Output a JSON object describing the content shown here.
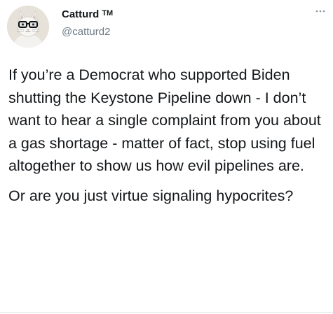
{
  "author": {
    "display_name": "Catturd",
    "badge": "TM",
    "handle": "@catturd2",
    "avatar_icon": "cat-with-glasses-avatar"
  },
  "menu_icon": "more-options-icon",
  "tweet": {
    "paragraphs": [
      "If you’re a Democrat who supported Biden shutting the Keystone Pipeline down - I don’t want to hear a single complaint from you about a gas shortage - matter of fact, stop using fuel altogether to show us how evil pipelines are.",
      "Or are you just virtue signaling hypocrites?"
    ]
  },
  "colors": {
    "text": "#14171a",
    "secondary_text": "#6b7884",
    "divider": "#e1e4e6"
  }
}
